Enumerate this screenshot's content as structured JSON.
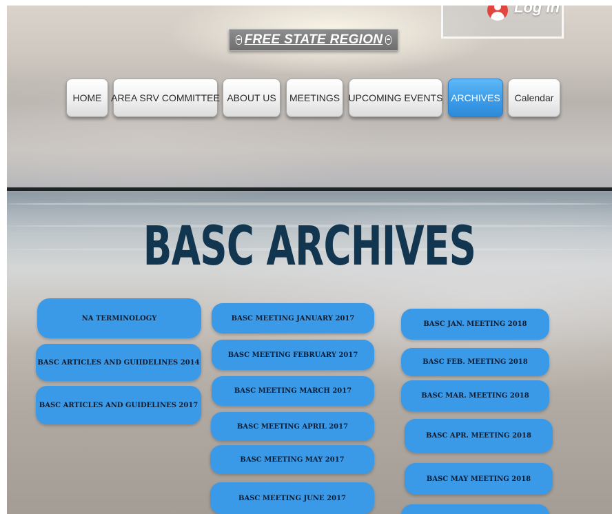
{
  "login": {
    "label": "Log In"
  },
  "logo": {
    "text": "FREE STATE REGION"
  },
  "nav": [
    {
      "label": "HOME",
      "active": false
    },
    {
      "label": "AREA SRV COMMITTEE",
      "active": false
    },
    {
      "label": "ABOUT US",
      "active": false
    },
    {
      "label": "MEETINGS",
      "active": false
    },
    {
      "label": "UPCOMING EVENTS",
      "active": false
    },
    {
      "label": "ARCHIVES",
      "active": true
    },
    {
      "label": "Calendar",
      "active": false
    }
  ],
  "heading": "BASC ARCHIVES",
  "columns": [
    [
      "NA TERMINOLOGY",
      "BASC ARTICLES AND GUIIDELINES 2014",
      "BASC ARTICLES AND GUIDELINES 2017"
    ],
    [
      "BASC MEETING JANUARY 2017",
      "BASC MEETING FEBRUARY 2017",
      "BASC MEETING MARCH 2017",
      "BASC MEETING APRIL 2017",
      "BASC MEETING MAY 2017",
      "BASC MEETING JUNE 2017"
    ],
    [
      "BASC JAN. MEETING 2018",
      "BASC FEB. MEETING 2018",
      "BASC MAR. MEETING 2018",
      "BASC APR. MEETING 2018",
      "BASC MAY MEETING 2018",
      ""
    ]
  ],
  "colors": {
    "accent": "#3b9ae8",
    "heading": "#123650",
    "login_icon": "#e1453f"
  }
}
